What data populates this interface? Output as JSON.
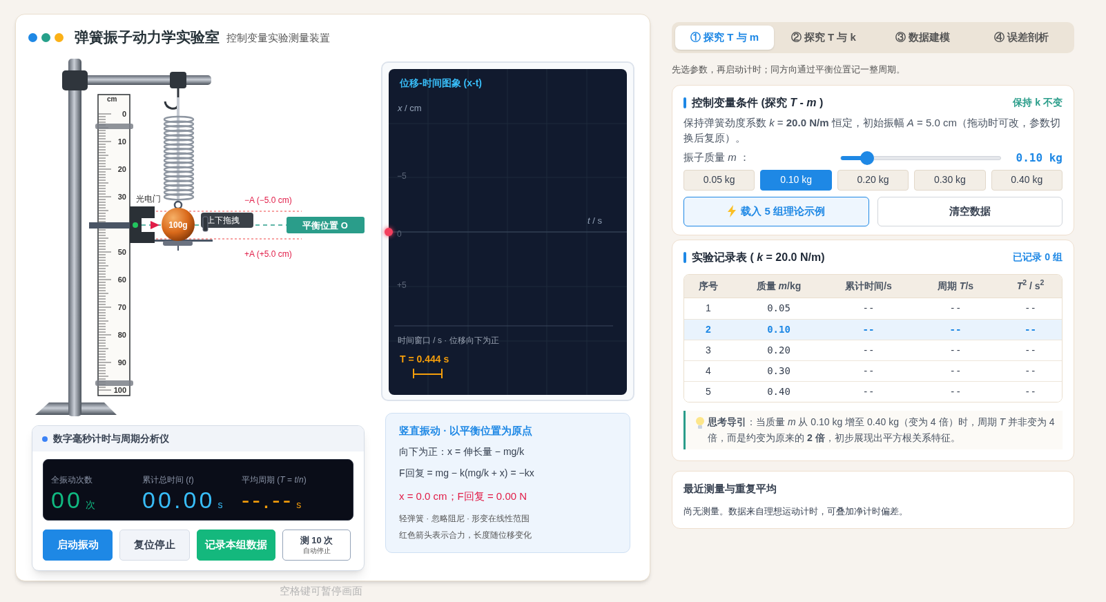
{
  "window": {
    "dots": [
      {
        "color": "#1e88e5"
      },
      {
        "color": "#26a08a"
      },
      {
        "color": "#fbb117"
      }
    ],
    "title": "弹簧振子动力学实验室",
    "subtitle": "控制变量实验测量装置"
  },
  "apparatus": {
    "ruler_unit": "cm",
    "ruler_labels": [
      "0",
      "10",
      "20",
      "30",
      "50",
      "60",
      "70",
      "80",
      "90",
      "100"
    ],
    "photogate_label": "光电门",
    "mass_label": "100g",
    "drag_tag": "上下拖拽",
    "upper_limit": "−A (−5.0 cm)",
    "lower_limit": "+A (+5.0 cm)",
    "equilibrium": "平衡位置 O"
  },
  "timer": {
    "title": "数字毫秒计时与周期分析仪",
    "readouts": [
      {
        "label": "全振动次数",
        "value": "00",
        "unit": "次",
        "color": "#10b981"
      },
      {
        "label": "累计总时间 (*t*)",
        "value": "00.00",
        "unit": "s",
        "color": "#38bdf8"
      },
      {
        "label": "平均周期 (*T* = *t*/*n*)",
        "value": "--.--",
        "unit": "s",
        "color": "#f59e0b"
      }
    ],
    "buttons": [
      {
        "label": "启动振动",
        "kind": "primary"
      },
      {
        "label": "复位停止",
        "kind": "secondary"
      },
      {
        "label": "记录本组数据",
        "kind": "success"
      },
      {
        "label": "测 10 次",
        "sublabel": "自动停止",
        "kind": "outline"
      }
    ]
  },
  "graph": {
    "title": "位移-时间图象 (x-t)",
    "y_axis": "*x* / cm",
    "x_axis": "*t* / s",
    "y_ticks": [
      "−5",
      "0",
      "+5"
    ],
    "caption": "时间窗口 / s · 位移向下为正",
    "period": "T = 0.444 s"
  },
  "physics": {
    "title": "竖直振动 · 以平衡位置为原点",
    "lines": [
      "向下为正：x = 伸长量 − mg/k",
      "F回复 = mg − k(mg/k + x) = −kx"
    ],
    "reading": "x = 0.0 cm；F回复 = 0.00 N",
    "notes": [
      "轻弹簧 · 忽略阻尼 · 形变在线性范围",
      "红色箭头表示合力，长度随位移变化"
    ]
  },
  "footer": "空格键可暂停画面",
  "tabs": [
    {
      "label": "① 探究 T 与 m",
      "selected": true
    },
    {
      "label": "② 探究 T 与 k",
      "selected": false
    },
    {
      "label": "③ 数据建模",
      "selected": false
    },
    {
      "label": "④ 误差剖析",
      "selected": false
    }
  ],
  "hint": "先选参数，再启动计时；同方向通过平衡位置记一整周期。",
  "conditions": {
    "title": "控制变量条件 (探究 *T* - *m* )",
    "badge": "保持 k 不变",
    "text": "保持弹簧劲度系数 *k* = **20.0 N/m** 恒定，初始振幅 *A* = 5.0 cm（拖动时可改，参数切换后复原）。",
    "slider": {
      "label": "振子质量 *m* ：",
      "level": 0.17,
      "value": "0.10 kg"
    },
    "options": [
      {
        "label": "0.05 kg",
        "selected": false
      },
      {
        "label": "0.10 kg",
        "selected": true
      },
      {
        "label": "0.20 kg",
        "selected": false
      },
      {
        "label": "0.30 kg",
        "selected": false
      },
      {
        "label": "0.40 kg",
        "selected": false
      }
    ],
    "actions": [
      {
        "label": "载入 5 组理论示例",
        "kind": "example"
      },
      {
        "label": "清空数据",
        "kind": "clear"
      }
    ]
  },
  "record": {
    "title": "实验记录表 ( *k* = 20.0 N/m)",
    "count": "已记录 0 组",
    "columns": [
      "序号",
      "质量 *m*/kg",
      "累计时间/s",
      "周期 *T*/s",
      "*T*$^{2}$ / s$^{2}$"
    ],
    "rows": [
      {
        "cells": [
          "1",
          "0.05",
          "--",
          "--",
          "--"
        ],
        "selected": false
      },
      {
        "cells": [
          "2",
          "0.10",
          "--",
          "--",
          "--"
        ],
        "selected": true
      },
      {
        "cells": [
          "3",
          "0.20",
          "--",
          "--",
          "--"
        ],
        "selected": false
      },
      {
        "cells": [
          "4",
          "0.30",
          "--",
          "--",
          "--"
        ],
        "selected": false
      },
      {
        "cells": [
          "5",
          "0.40",
          "--",
          "--",
          "--"
        ],
        "selected": false
      }
    ],
    "tip": "**思考导引**：当质量 *m* 从 0.10 kg 增至 0.40 kg（变为 4 倍）时，周期 *T* 并非变为 4 倍，而是约变为原来的 **2 倍**，初步展现出平方根关系特征。"
  },
  "recent": {
    "title": "最近测量与重复平均",
    "text": "尚无测量。数据来自理想运动计时，可叠加净计时偏差。"
  }
}
